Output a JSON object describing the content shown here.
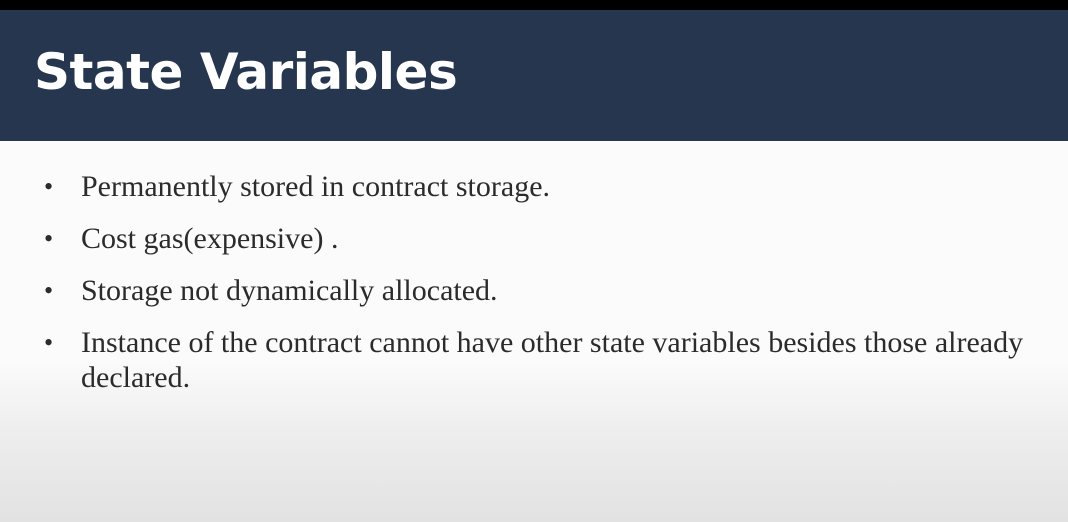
{
  "slide": {
    "title": "State Variables",
    "bullets": [
      "Permanently stored in contract storage.",
      "Cost gas(expensive) .",
      "Storage not dynamically allocated.",
      "Instance of the contract cannot have other state variables besides those already declared."
    ],
    "bullet_glyph": "•"
  },
  "colors": {
    "title_bar": "#26364f",
    "title_text": "#ffffff",
    "body_text": "#2b2b2b",
    "slide_background": "#fbfbfb"
  }
}
